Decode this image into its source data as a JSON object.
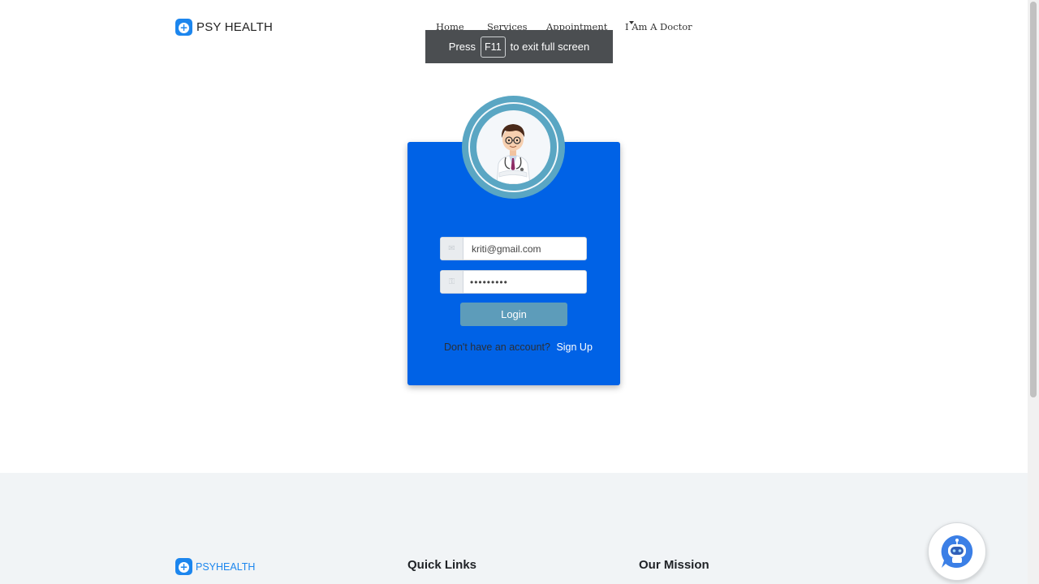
{
  "header": {
    "brand": "PSY HEALTH",
    "nav": {
      "home": "Home",
      "services": "Services",
      "appointment": "Appointment",
      "doctor": "I Am A Doctor"
    }
  },
  "fullscreen_toast": {
    "before": "Press",
    "key": "F11",
    "after": "to exit full screen"
  },
  "login": {
    "email_value": "kriti@gmail.com",
    "password_value": "•••••••••",
    "login_button": "Login",
    "no_account_text": "Don't have an account?",
    "signup_link": "Sign Up"
  },
  "footer": {
    "brand": "PSYHEALTH",
    "quick_links": "Quick Links",
    "our_mission": "Our Mission"
  },
  "colors": {
    "card_blue": "#0062e6",
    "brand_blue": "#1c86ee",
    "login_button": "#5d9cba"
  }
}
